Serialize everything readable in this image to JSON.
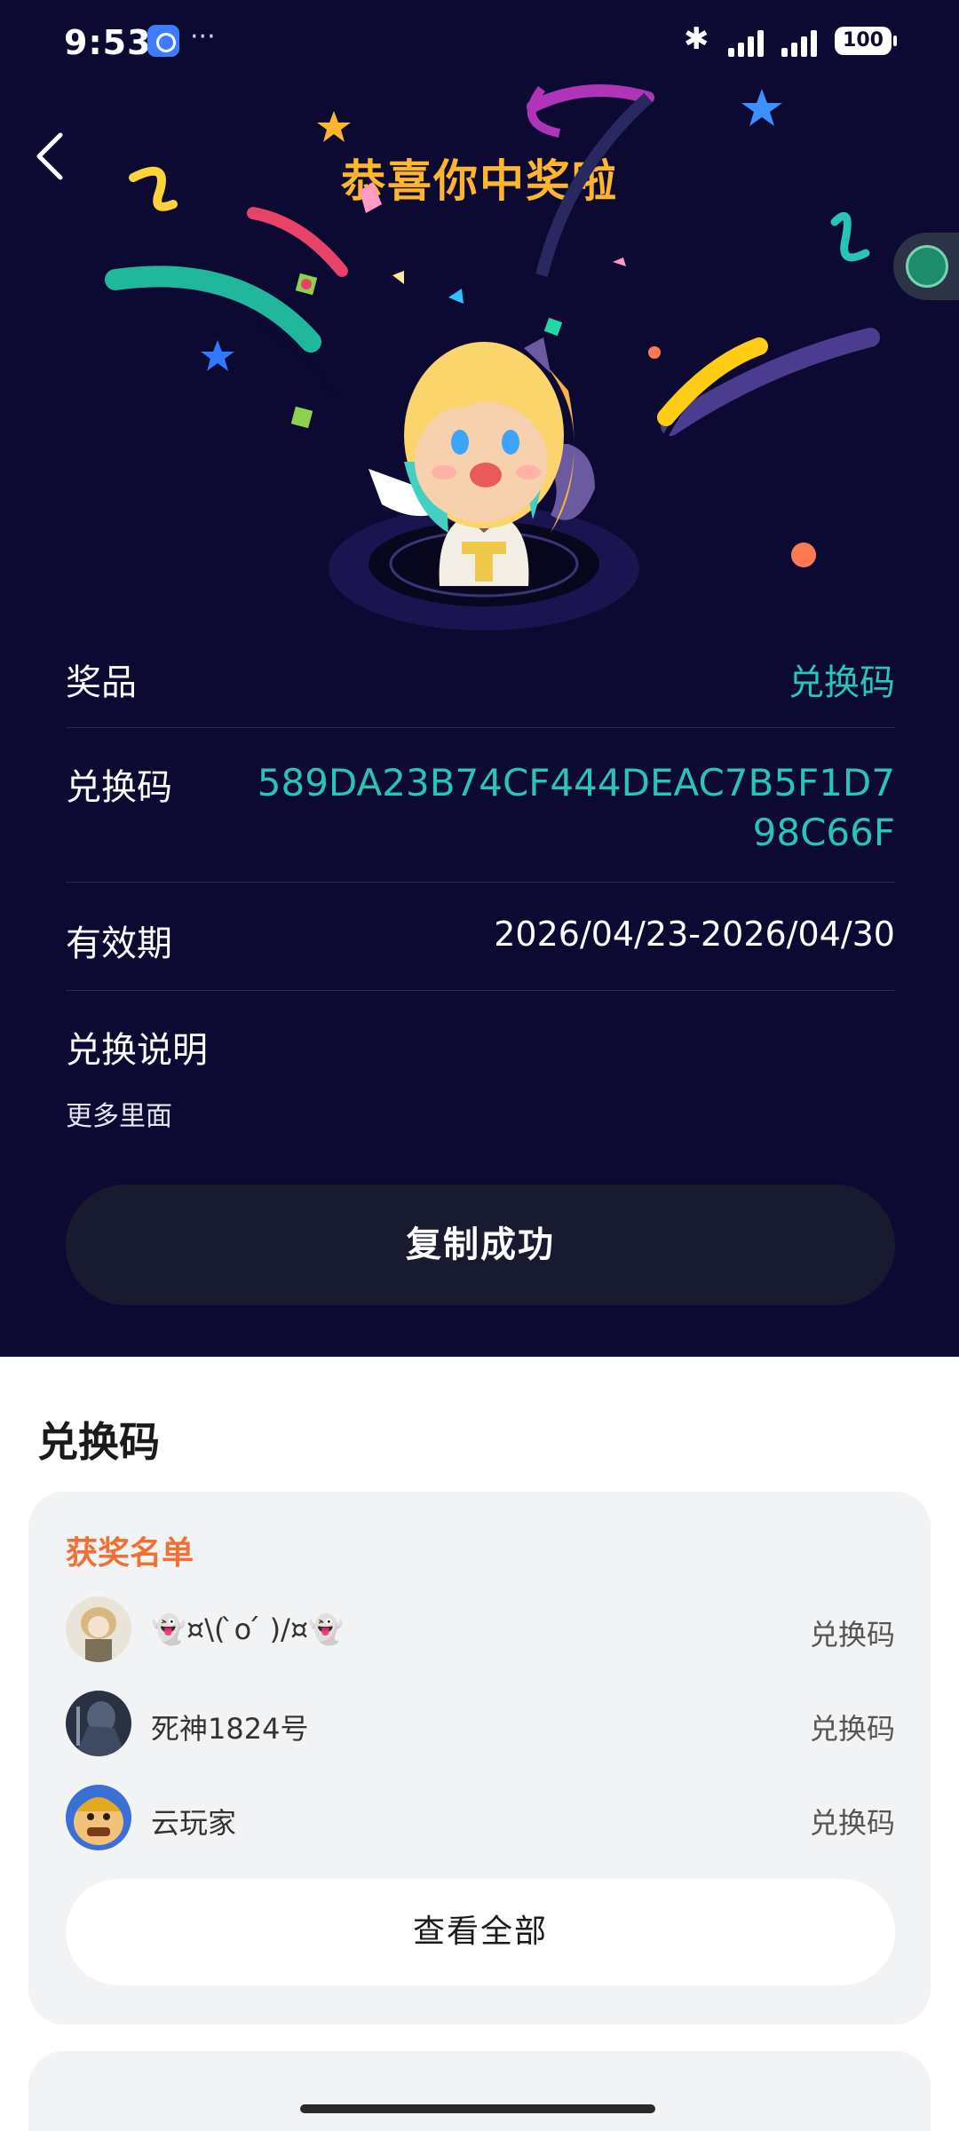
{
  "status_bar": {
    "time": "9:53",
    "battery": "100",
    "more": "···"
  },
  "header": {
    "title": "恭喜你中奖啦"
  },
  "prize_info": {
    "prize_label": "奖品",
    "prize_value": "兑换码",
    "code_label": "兑换码",
    "code_value": "589DA23B74CF444DEAC7B5F1D798C66F",
    "validity_label": "有效期",
    "validity_value": "2026/04/23-2026/04/30",
    "instructions_label": "兑换说明",
    "instructions_text": "更多里面"
  },
  "copy_button": {
    "label": "复制成功"
  },
  "section": {
    "title": "兑换码"
  },
  "winners_card": {
    "title": "获奖名单",
    "winners": [
      {
        "name": "👻¤\\( ̀o ́ )/¤👻",
        "prize": "兑换码"
      },
      {
        "name": "死神1824号",
        "prize": "兑换码"
      },
      {
        "name": "云玩家",
        "prize": "兑换码"
      }
    ],
    "view_all_label": "查看全部"
  },
  "colors": {
    "background": "#0c0a33",
    "accent_title": "#ffb52e",
    "accent_teal": "#28c4b6",
    "winners_title": "#f07035"
  }
}
